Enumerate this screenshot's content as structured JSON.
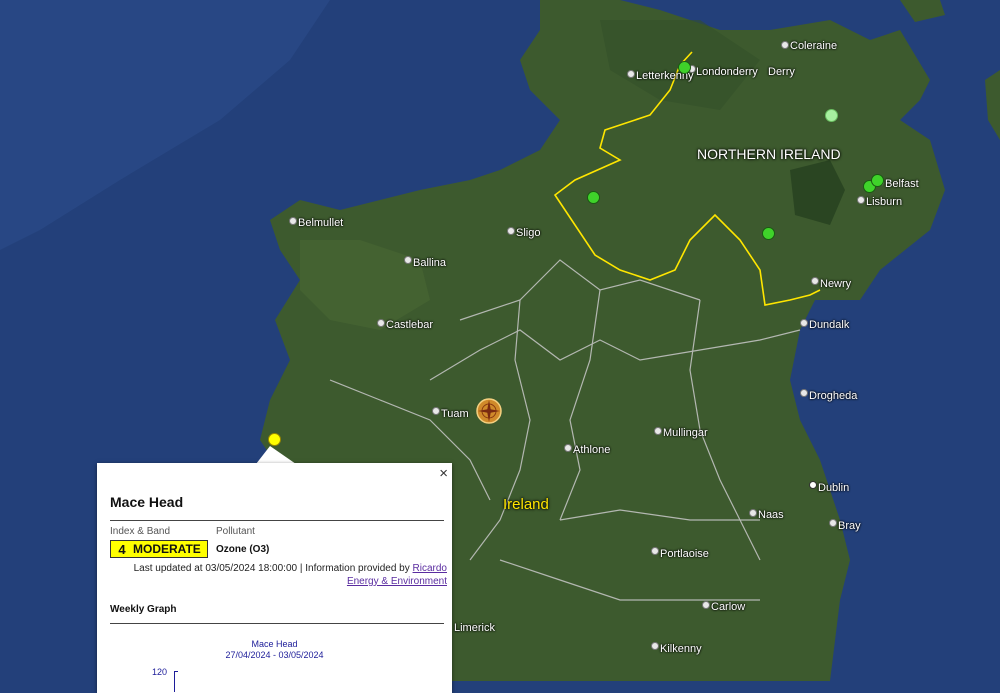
{
  "map": {
    "places": [
      {
        "name": "Coleraine"
      },
      {
        "name": "Letterkenny"
      },
      {
        "name": "Londonderry"
      },
      {
        "name": "Derry"
      },
      {
        "name": "Belfast"
      },
      {
        "name": "Lisburn"
      },
      {
        "name": "Belmullet"
      },
      {
        "name": "Sligo"
      },
      {
        "name": "Ballina"
      },
      {
        "name": "Newry"
      },
      {
        "name": "Castlebar"
      },
      {
        "name": "Dundalk"
      },
      {
        "name": "Drogheda"
      },
      {
        "name": "Tuam"
      },
      {
        "name": "Mullingar"
      },
      {
        "name": "Athlone"
      },
      {
        "name": "Dublin"
      },
      {
        "name": "Naas"
      },
      {
        "name": "Bray"
      },
      {
        "name": "Portlaoise"
      },
      {
        "name": "Carlow"
      },
      {
        "name": "Limerick"
      },
      {
        "name": "Kilkenny"
      }
    ],
    "regions": {
      "northern_ireland": "NORTHERN IRELAND",
      "ireland": "Ireland"
    },
    "colors": {
      "sea": "#23407a",
      "land": "#3d5a2e",
      "border": "#ffe600",
      "station_green": "#3fd22a",
      "station_light": "#a8f0a0",
      "station_yellow": "#ffff00"
    }
  },
  "popup": {
    "close": "×",
    "station": "Mace Head",
    "index_band_label": "Index & Band",
    "pollutant_label": "Pollutant",
    "index": "4",
    "band": "MODERATE",
    "band_color": "#ffff00",
    "pollutant": "Ozone (O3)",
    "updated_text": "Last updated at 03/05/2024 18:00:00 | Information provided by ",
    "provider_link_1": "Ricardo",
    "provider_link_2": "Energy & Environment",
    "weekly_graph_label": "Weekly Graph",
    "graph": {
      "title": "Mace Head",
      "date_range": "27/04/2024 - 03/05/2024",
      "y_tick_top": "120"
    }
  }
}
